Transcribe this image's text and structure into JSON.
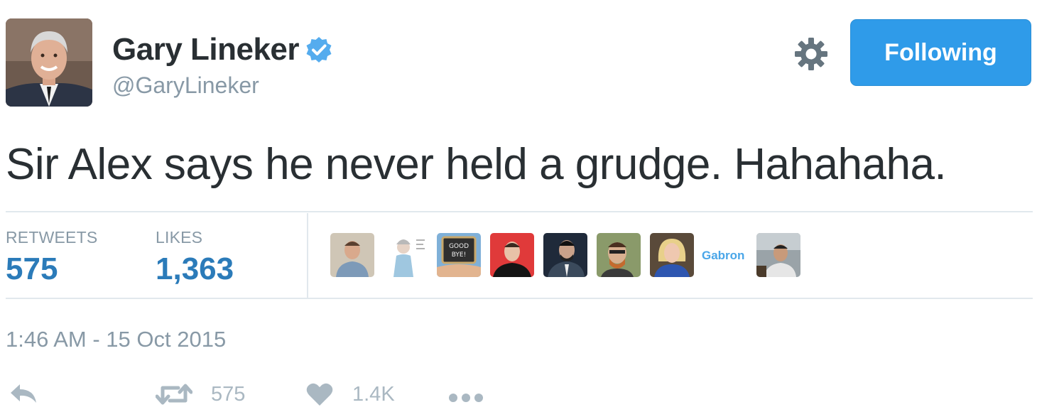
{
  "author": {
    "name": "Gary Lineker",
    "handle": "@GaryLineker",
    "verified": true
  },
  "follow_button": {
    "label": "Following"
  },
  "tweet": {
    "text": "Sir Alex says he never held a grudge. Hahahaha."
  },
  "stats": {
    "retweets_label": "RETWEETS",
    "retweets_value": "575",
    "likes_label": "LIKES",
    "likes_value": "1,363"
  },
  "liked_by": {
    "text_avatar_label": "Gabron",
    "chalkboard_text": [
      "GOOD",
      "BYE!"
    ]
  },
  "timestamp": "1:46 AM - 15 Oct 2015",
  "actions": {
    "retweet_count": "575",
    "like_count": "1.4K"
  },
  "colors": {
    "follow_button": "#2f9be9",
    "stat_value": "#2b7bb9",
    "verified_badge": "#55acee",
    "muted_text": "#8899a6",
    "icon_gray": "#aab8c2"
  },
  "icons": [
    "verified-badge-icon",
    "gear-icon",
    "reply-icon",
    "retweet-icon",
    "heart-icon",
    "more-icon"
  ]
}
